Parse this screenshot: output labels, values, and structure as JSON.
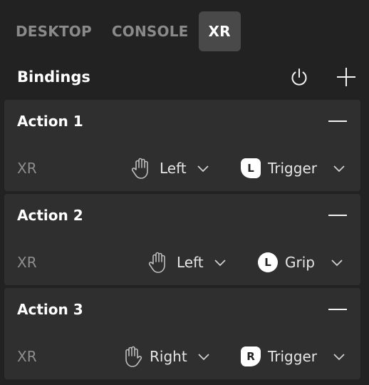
{
  "tabs": [
    {
      "label": "DESKTOP",
      "active": false
    },
    {
      "label": "CONSOLE",
      "active": false
    },
    {
      "label": "XR",
      "active": true
    }
  ],
  "header": {
    "title": "Bindings",
    "icons": [
      "power-icon",
      "plus-icon"
    ]
  },
  "actions": [
    {
      "title": "Action 1",
      "device": "XR",
      "hand": "Left",
      "button_badge": "L",
      "button": "Trigger"
    },
    {
      "title": "Action 2",
      "device": "XR",
      "hand": "Left",
      "button_badge": "L",
      "button": "Grip"
    },
    {
      "title": "Action 3",
      "device": "XR",
      "hand": "Right",
      "button_badge": "R",
      "button": "Trigger"
    }
  ],
  "colors": {
    "background": "#222222",
    "card": "#2f2f2f",
    "active_tab": "#494949",
    "text": "#e8e8e8",
    "muted": "#8a8a8a"
  }
}
